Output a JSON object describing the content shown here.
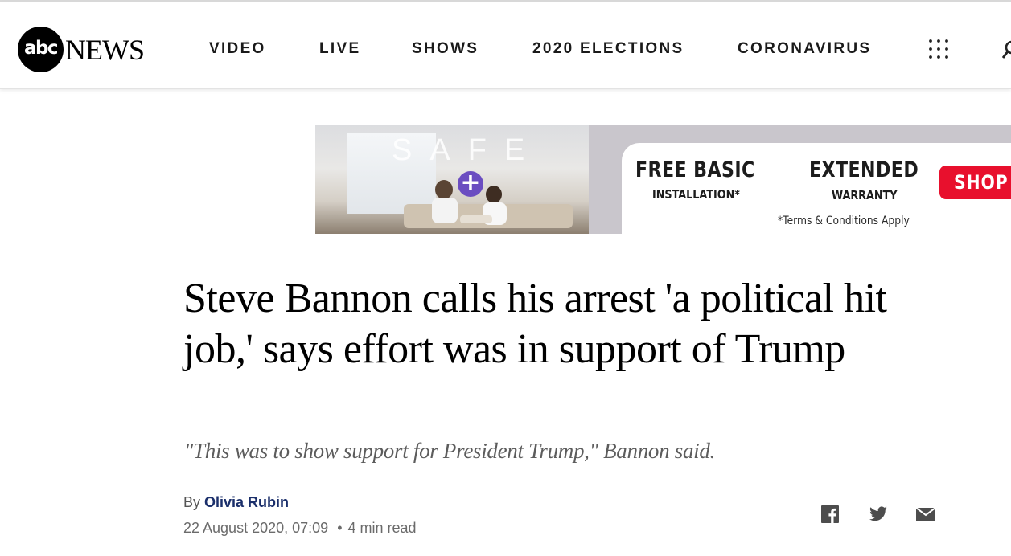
{
  "header": {
    "logo": {
      "abc": "abc",
      "news": "NEWS"
    },
    "nav": [
      {
        "label": "VIDEO"
      },
      {
        "label": "LIVE"
      },
      {
        "label": "SHOWS"
      },
      {
        "label": "2020 ELECTIONS"
      },
      {
        "label": "CORONAVIRUS"
      }
    ],
    "icons": {
      "menu": "grid-menu-icon",
      "search": "search-icon"
    }
  },
  "ad": {
    "photo_text": "SAFE",
    "free_basic": "FREE BASIC",
    "installation": "INSTALLATION*",
    "plus": "+",
    "extended": "EXTENDED",
    "warranty": "WARRANTY",
    "terms": "*Terms & Conditions Apply",
    "cta": "SHOP N",
    "colors": {
      "cta": "#e8102d",
      "plus": "#6b4dc1"
    }
  },
  "article": {
    "headline": "Steve Bannon calls his arrest 'a political hit job,' says effort was in support of Trump",
    "subhead": "\"This was to show support for President Trump,\" Bannon said.",
    "byline_prefix": "By",
    "author": "Olivia Rubin",
    "date": "22 August 2020, 07:09",
    "separator": "•",
    "read_time": "4 min read",
    "author_color": "#1b2f6b"
  },
  "share": {
    "icons": [
      "facebook-icon",
      "twitter-icon",
      "email-icon"
    ]
  }
}
